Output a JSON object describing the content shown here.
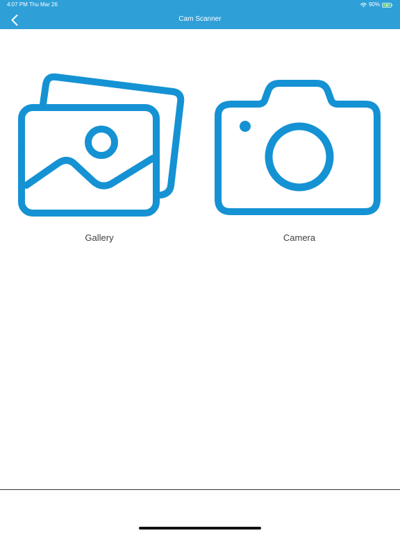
{
  "status_bar": {
    "time": "4:07 PM",
    "date": "Thu Mar 26",
    "battery_percent": "90%",
    "wifi_icon": "wifi-icon",
    "battery_icon": "battery-charging-icon"
  },
  "nav": {
    "title": "Cam Scanner",
    "back_icon": "chevron-left-icon"
  },
  "options": {
    "gallery": {
      "label": "Gallery",
      "icon": "gallery-icon"
    },
    "camera": {
      "label": "Camera",
      "icon": "camera-icon"
    }
  },
  "colors": {
    "accent": "#2f9fd8",
    "icon": "#1592d3",
    "label": "#404040"
  }
}
